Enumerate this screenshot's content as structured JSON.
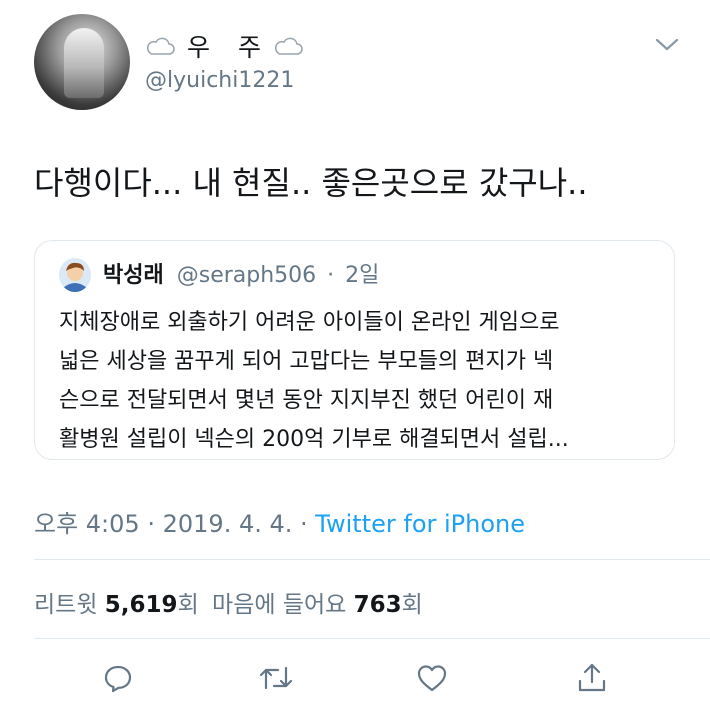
{
  "user": {
    "display_name": "우 주",
    "handle": "@lyuichi1221",
    "icons": [
      "cloud-icon",
      "cloud-icon"
    ]
  },
  "tweet": {
    "text": "다행이다... 내 현질.. 좋은곳으로 갔구나.."
  },
  "quoted_tweet": {
    "name": "박성래",
    "handle": "@seraph506",
    "separator": "·",
    "time": "2일",
    "lines": [
      "지체장애로 외출하기 어려운 아이들이 온라인 게임으로",
      "넓은 세상을 꿈꾸게 되어 고맙다는 부모들의 편지가 넥",
      "슨으로 전달되면서 몇년 동안 지지부진 했던 어린이 재",
      "활병원 설립이 넥슨의 200억 기부로 해결되면서 설립..."
    ]
  },
  "meta": {
    "time": "오후 4:05",
    "sep1": "·",
    "date": "2019. 4. 4.",
    "sep2": "·",
    "source": "Twitter for iPhone"
  },
  "stats": {
    "retweets_label": "리트윗",
    "retweets_count": "5,619",
    "retweets_unit": "회",
    "likes_label": "마음에 들어요",
    "likes_count": "763",
    "likes_unit": "회"
  },
  "actions": [
    "reply-icon",
    "retweet-icon",
    "like-icon",
    "share-icon"
  ],
  "colors": {
    "text": "#14171a",
    "secondary": "#657786",
    "link": "#1da1f2",
    "border": "#e1e8ed"
  }
}
